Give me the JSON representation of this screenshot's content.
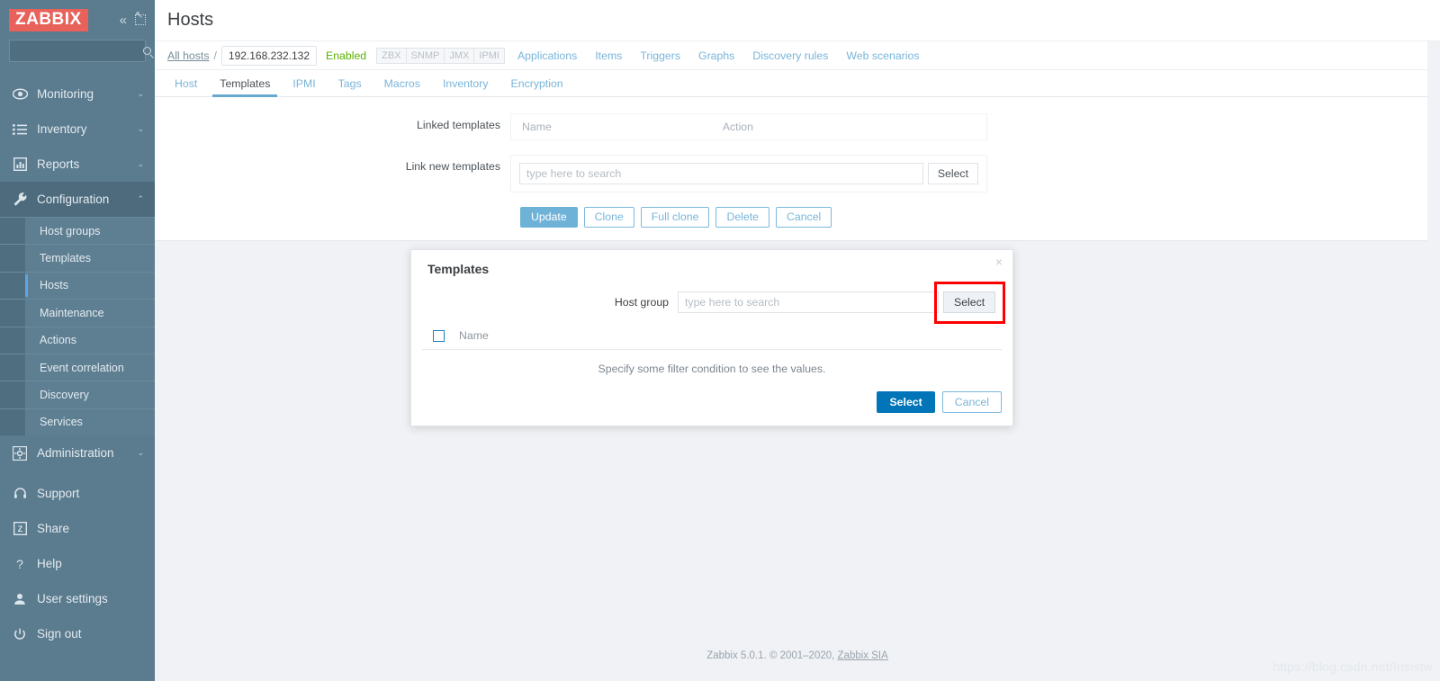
{
  "sidebar": {
    "logo": "ZABBIX",
    "collapse_icon": "«",
    "hide_icon": "hide-sidebar",
    "search_placeholder": "",
    "search_value": "",
    "nav": [
      {
        "label": "Monitoring",
        "icon": "eye-icon",
        "chevron": "⌄"
      },
      {
        "label": "Inventory",
        "icon": "list-icon",
        "chevron": "⌄"
      },
      {
        "label": "Reports",
        "icon": "bar-chart-icon",
        "chevron": "⌄"
      },
      {
        "label": "Configuration",
        "icon": "wrench-icon",
        "chevron": "⌃"
      }
    ],
    "submenu": [
      {
        "label": "Host groups"
      },
      {
        "label": "Templates"
      },
      {
        "label": "Hosts"
      },
      {
        "label": "Maintenance"
      },
      {
        "label": "Actions"
      },
      {
        "label": "Event correlation"
      },
      {
        "label": "Discovery"
      },
      {
        "label": "Services"
      }
    ],
    "admin": {
      "label": "Administration",
      "icon": "gear-icon",
      "chevron": "⌄"
    },
    "bottom": [
      {
        "label": "Support",
        "icon": "headset-icon"
      },
      {
        "label": "Share",
        "icon": "zabbix-z-icon"
      },
      {
        "label": "Help",
        "icon": "question-icon"
      },
      {
        "label": "User settings",
        "icon": "user-icon"
      },
      {
        "label": "Sign out",
        "icon": "power-icon"
      }
    ]
  },
  "header": {
    "title": "Hosts"
  },
  "breadcrumb": {
    "all_hosts": "All hosts",
    "separator": "/",
    "host": "192.168.232.132",
    "status": "Enabled",
    "badges": [
      "ZBX",
      "SNMP",
      "JMX",
      "IPMI"
    ],
    "links": [
      "Applications",
      "Items",
      "Triggers",
      "Graphs",
      "Discovery rules",
      "Web scenarios"
    ]
  },
  "tabs": [
    {
      "label": "Host"
    },
    {
      "label": "Templates"
    },
    {
      "label": "IPMI"
    },
    {
      "label": "Tags"
    },
    {
      "label": "Macros"
    },
    {
      "label": "Inventory"
    },
    {
      "label": "Encryption"
    }
  ],
  "form": {
    "linked_templates_label": "Linked templates",
    "col_name": "Name",
    "col_action": "Action",
    "link_new_label": "Link new templates",
    "search_placeholder": "type here to search",
    "search_value": "",
    "select_button": "Select",
    "buttons": [
      {
        "label": "Update",
        "primary": true
      },
      {
        "label": "Clone",
        "primary": false
      },
      {
        "label": "Full clone",
        "primary": false
      },
      {
        "label": "Delete",
        "primary": false
      },
      {
        "label": "Cancel",
        "primary": false
      }
    ]
  },
  "modal": {
    "title": "Templates",
    "close_icon": "×",
    "host_group_label": "Host group",
    "host_group_placeholder": "type here to search",
    "host_group_value": "",
    "select_button": "Select",
    "column_name": "Name",
    "empty_message": "Specify some filter condition to see the values.",
    "footer_select": "Select",
    "footer_cancel": "Cancel"
  },
  "footer": {
    "text": "Zabbix 5.0.1. © 2001–2020, ",
    "link": "Zabbix SIA",
    "watermark": "https://blog.csdn.net/Insistw"
  },
  "colors": {
    "brand_red": "#e8615a",
    "sidebar": "#5b7b8e",
    "accent_blue": "#78b5d9",
    "modal_primary": "#0275b8",
    "status_green": "#59b200",
    "annotation_red": "#fe0000"
  }
}
